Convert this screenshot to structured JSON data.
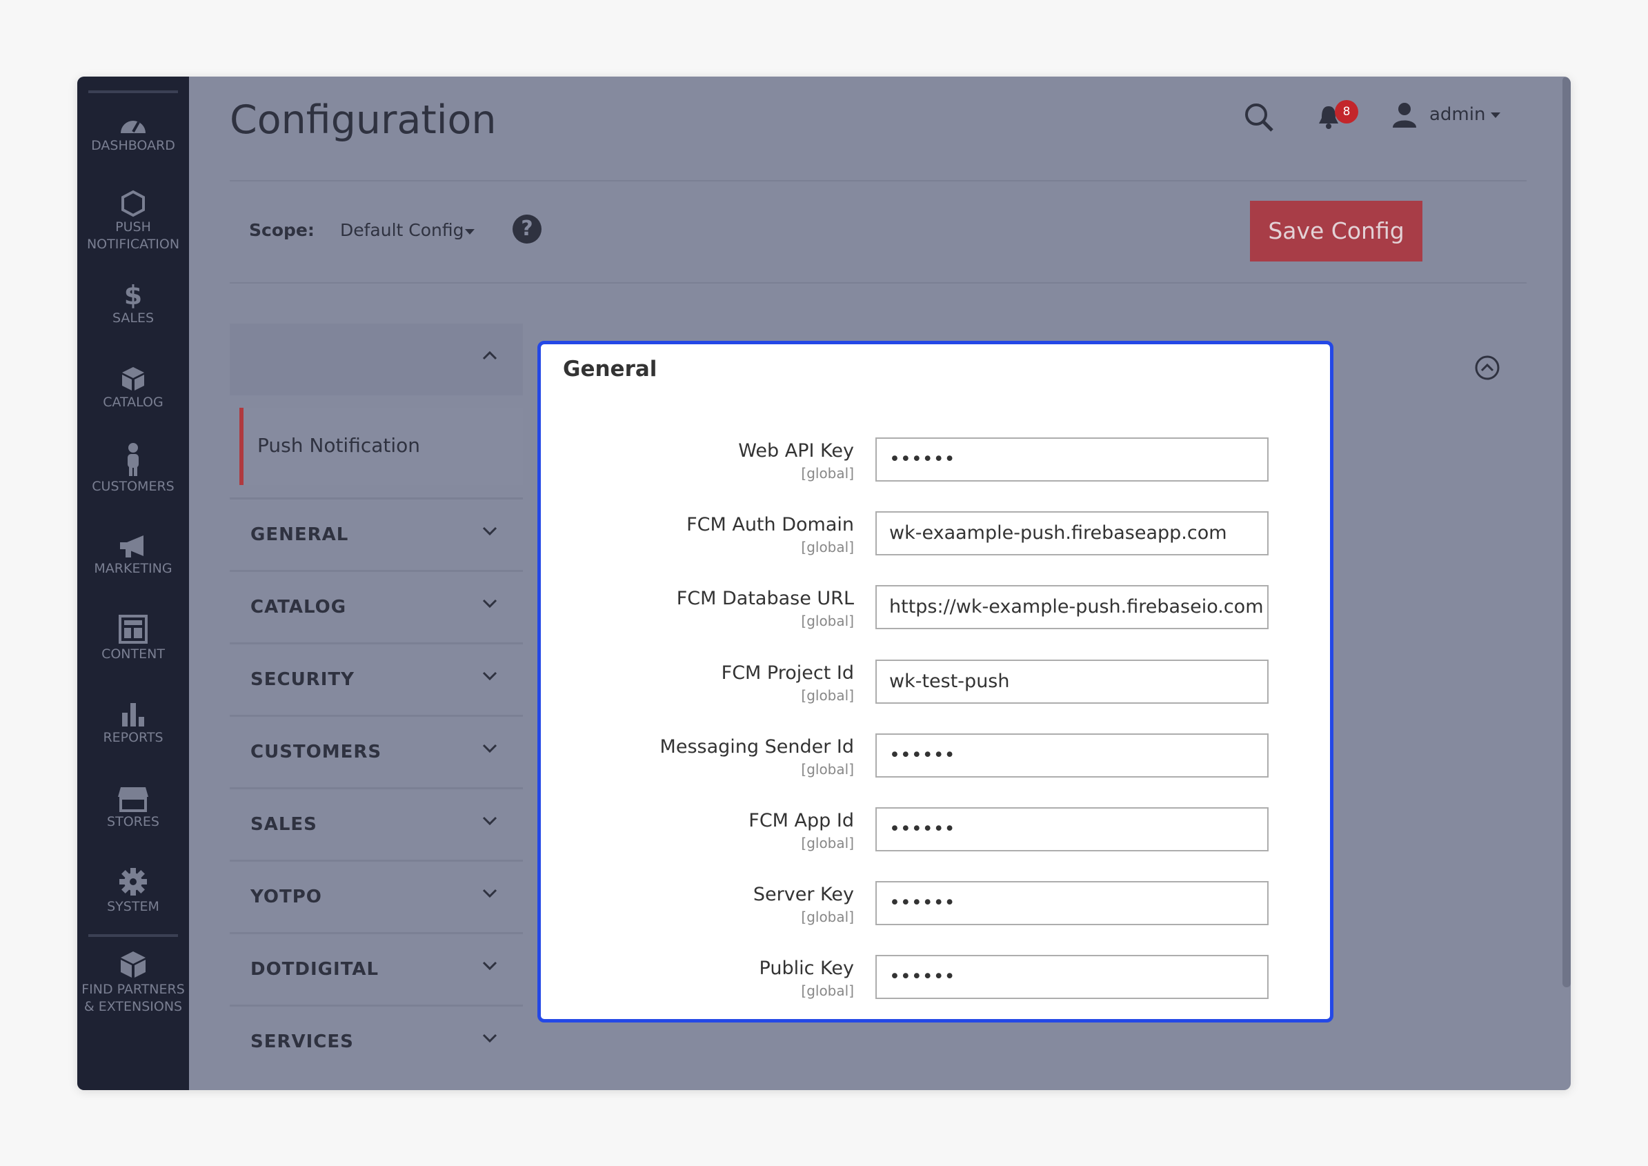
{
  "nav": {
    "items": [
      {
        "label": "DASHBOARD",
        "icon": "dashboard-icon"
      },
      {
        "label": "PUSH NOTIFICATION",
        "icon": "hexagon-icon"
      },
      {
        "label": "SALES",
        "icon": "dollar-icon"
      },
      {
        "label": "CATALOG",
        "icon": "box-icon"
      },
      {
        "label": "CUSTOMERS",
        "icon": "person-icon"
      },
      {
        "label": "MARKETING",
        "icon": "megaphone-icon"
      },
      {
        "label": "CONTENT",
        "icon": "layout-icon"
      },
      {
        "label": "REPORTS",
        "icon": "bar-chart-icon"
      },
      {
        "label": "STORES",
        "icon": "storefront-icon"
      },
      {
        "label": "SYSTEM",
        "icon": "gear-icon"
      },
      {
        "label": "FIND PARTNERS & EXTENSIONS",
        "icon": "cube-icon"
      }
    ]
  },
  "header": {
    "title": "Configuration",
    "notification_count": "8",
    "user": "admin"
  },
  "scope": {
    "label": "Scope:",
    "value": "Default Config",
    "help": "?"
  },
  "toolbar": {
    "save_label": "Save Config"
  },
  "tabs": {
    "active": "Push Notification",
    "sections": [
      "GENERAL",
      "CATALOG",
      "SECURITY",
      "CUSTOMERS",
      "SALES",
      "YOTPO",
      "DOTDIGITAL",
      "SERVICES"
    ]
  },
  "panel": {
    "title": "General",
    "fields": [
      {
        "label": "Web API Key",
        "scope": "[global]",
        "value": "••••••"
      },
      {
        "label": "FCM Auth Domain",
        "scope": "[global]",
        "value": "wk-exaample-push.firebaseapp.com"
      },
      {
        "label": "FCM Database URL",
        "scope": "[global]",
        "value": "https://wk-example-push.firebaseio.com"
      },
      {
        "label": "FCM Project Id",
        "scope": "[global]",
        "value": "wk-test-push"
      },
      {
        "label": "Messaging Sender Id",
        "scope": "[global]",
        "value": "••••••"
      },
      {
        "label": "FCM App Id",
        "scope": "[global]",
        "value": "••••••"
      },
      {
        "label": "Server Key",
        "scope": "[global]",
        "value": "••••••"
      },
      {
        "label": "Public Key",
        "scope": "[global]",
        "value": "••••••"
      }
    ]
  },
  "colors": {
    "nav_bg": "#1e2233",
    "overlay": "#858a9e",
    "accent": "#a83d47",
    "highlight_border": "#2448e6"
  }
}
